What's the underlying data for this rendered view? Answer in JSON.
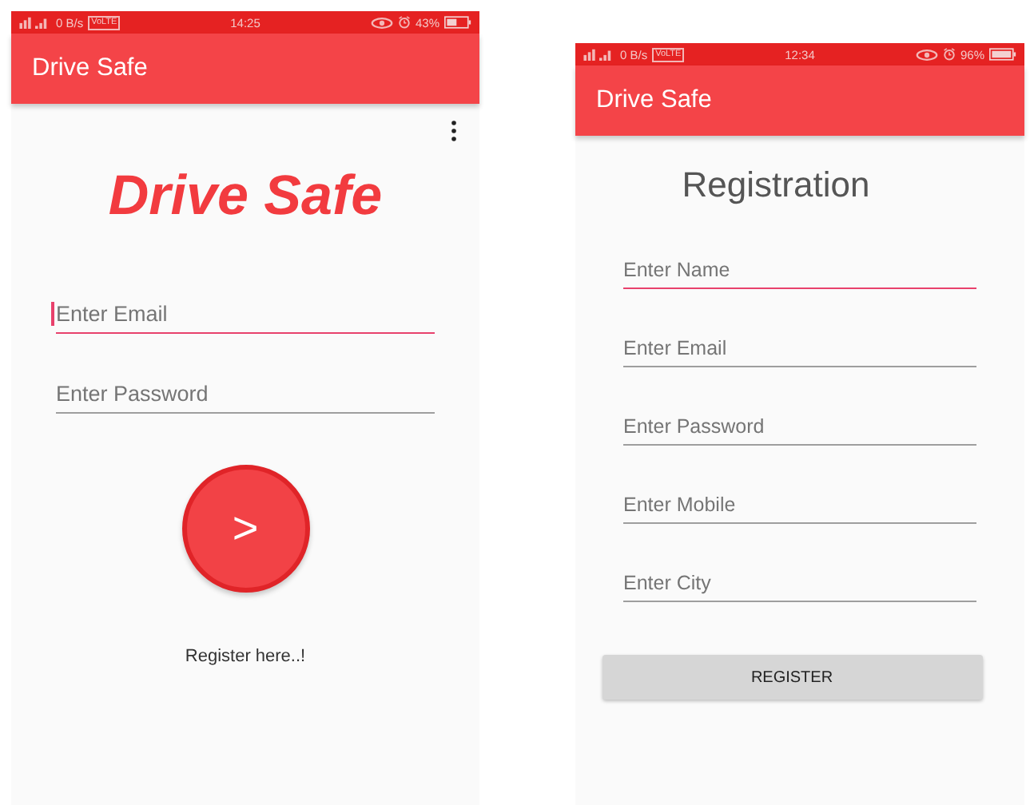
{
  "login_screen": {
    "status_bar": {
      "speed": "0 B/s",
      "volte": "VoLTE",
      "time": "14:25",
      "battery": "43%"
    },
    "app_bar": {
      "title": "Drive Safe"
    },
    "logo": "Drive Safe",
    "fields": [
      {
        "placeholder": "Enter Email",
        "focused": true
      },
      {
        "placeholder": "Enter Password",
        "focused": false
      }
    ],
    "submit_button": ">",
    "register_link": "Register here..!"
  },
  "registration_screen": {
    "status_bar": {
      "speed": "0 B/s",
      "volte": "VoLTE",
      "time": "12:34",
      "battery": "96%"
    },
    "app_bar": {
      "title": "Drive Safe"
    },
    "heading": "Registration",
    "fields": [
      {
        "placeholder": "Enter Name",
        "focused": true
      },
      {
        "placeholder": "Enter Email",
        "focused": false
      },
      {
        "placeholder": "Enter Password",
        "focused": false
      },
      {
        "placeholder": "Enter Mobile",
        "focused": false
      },
      {
        "placeholder": "Enter City",
        "focused": false
      }
    ],
    "button": "REGISTER"
  }
}
